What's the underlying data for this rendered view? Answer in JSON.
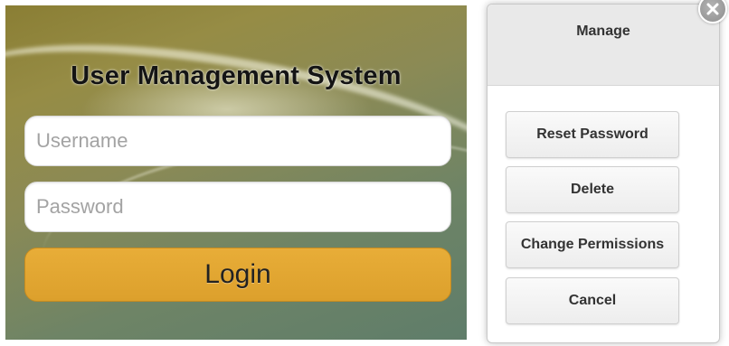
{
  "login": {
    "title": "User Management System",
    "username_placeholder": "Username",
    "password_placeholder": "Password",
    "login_label": "Login"
  },
  "popup": {
    "title": "Manage",
    "close_icon": "close-icon",
    "buttons": {
      "reset_password": "Reset Password",
      "delete": "Delete",
      "change_permissions": "Change Permissions",
      "cancel": "Cancel"
    }
  },
  "colors": {
    "login_button": "#e0a431",
    "panel_background": "#8a8a50",
    "popup_header": "#e9e9e9"
  }
}
